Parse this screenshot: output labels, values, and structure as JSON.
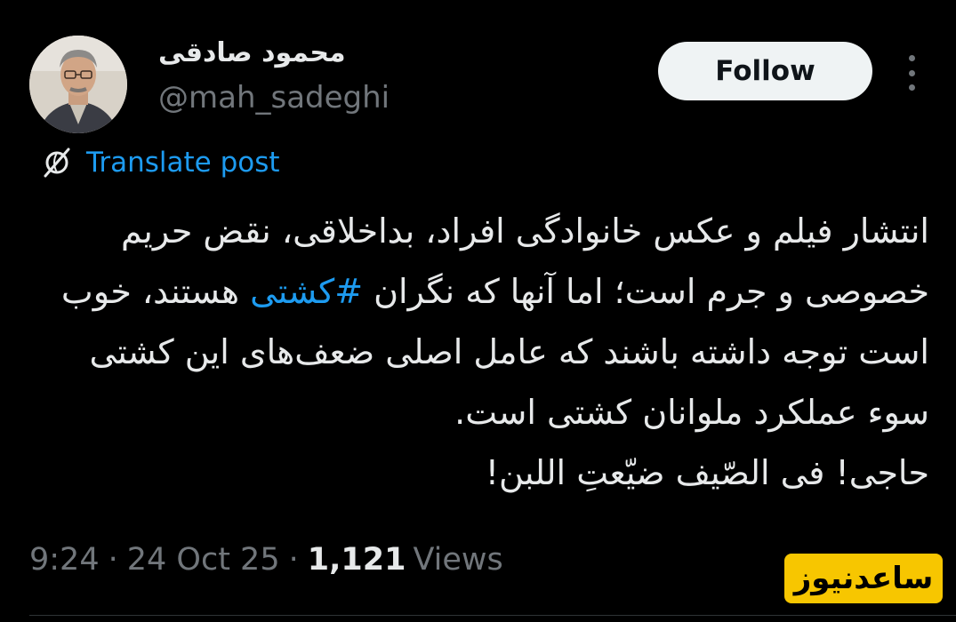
{
  "author": {
    "name": "محمود صادقی",
    "handle": "@mah_sadeghi"
  },
  "follow_label": "Follow",
  "more_icon": "more-horizontal-icon",
  "translate": {
    "icon": "translate-globe-icon",
    "label": "Translate post"
  },
  "post": {
    "text_before": "انتشار فیلم و عکس خانوادگی افراد، بداخلاقی، نقض حریم خصوصی و جرم است؛ اما آنها که نگران ",
    "hashtag": "#کشتی",
    "text_after": " هستند، خوب است توجه داشته باشند که عامل اصلی ضعف‌های این کشتی سوء عملکرد ملوانان کشتی است.",
    "text_last": "حاجی!  فی الصّیف ضیّعتِ اللبن!"
  },
  "meta": {
    "time": "9:24",
    "date": "24 Oct 25",
    "views_count": "1,121",
    "views_label": "Views"
  },
  "watermark": "ساعدنیوز",
  "colors": {
    "background": "#000000",
    "accent": "#1d9bf0",
    "secondary_text": "#71767b",
    "watermark_bg": "#f7c600"
  }
}
